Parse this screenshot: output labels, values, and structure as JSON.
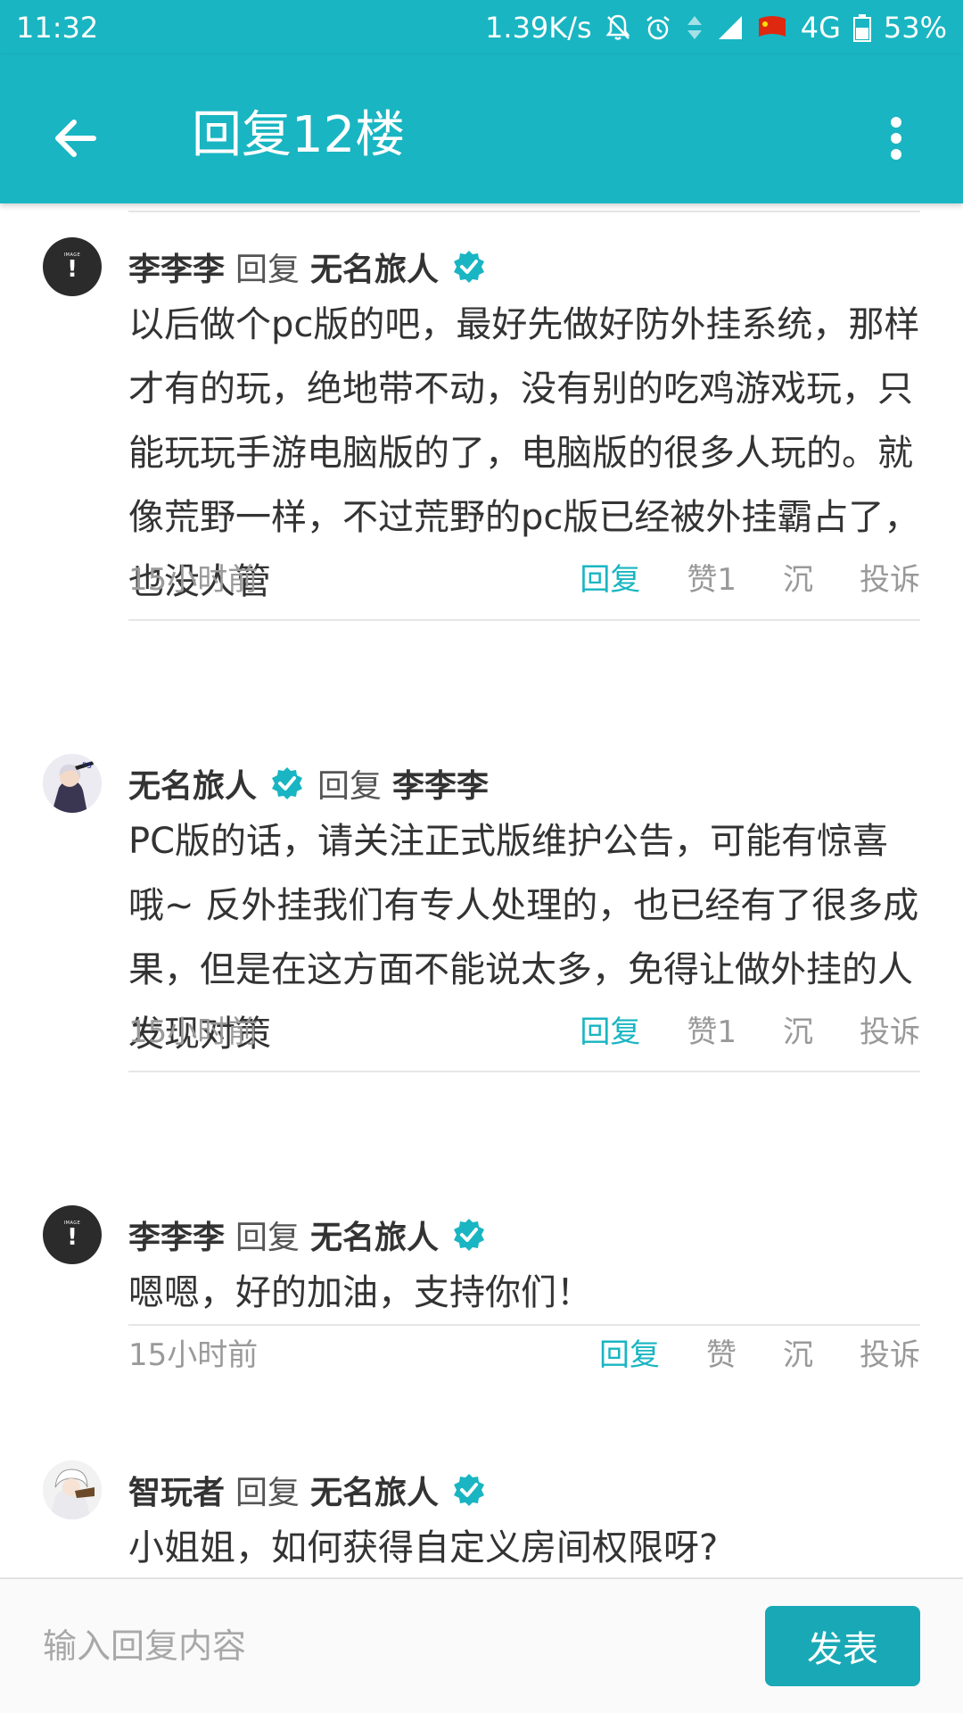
{
  "status_bar": {
    "time": "11:32",
    "net_speed": "1.39K/s",
    "network": "4G",
    "battery": "53%",
    "icons": [
      "mute-bell-icon",
      "alarm-icon",
      "data-arrows-icon",
      "signal-icon",
      "flag-icon",
      "battery-icon"
    ]
  },
  "header": {
    "title": "回复12楼",
    "back_icon": "back-arrow-icon",
    "more_icon": "more-vertical-icon"
  },
  "colors": {
    "accent": "#19b5c2",
    "text": "#333333",
    "muted": "#999999",
    "divider": "#e6e6e6"
  },
  "replies": [
    {
      "avatar": "default-avatar",
      "avatar_small_text": "IMAGE",
      "author": "李李李",
      "reply_word": "回复",
      "target": "无名旅人",
      "target_verified": true,
      "content": "以后做个pc版的吧，最好先做好防外挂系统，那样才有的玩，绝地带不动，没有别的吃鸡游戏玩，只能玩玩手游电脑版的了，电脑版的很多人玩的。就像荒野一样，不过荒野的pc版已经被外挂霸占了，也没人管",
      "time": "15小时前",
      "actions": {
        "reply": "回复",
        "like": "赞1",
        "sink": "沉",
        "report": "投诉"
      }
    },
    {
      "avatar": "anime-avatar",
      "author": "无名旅人",
      "author_verified": true,
      "reply_word": "回复",
      "target": "李李李",
      "content": "PC版的话，请关注正式版维护公告，可能有惊喜哦~ 反外挂我们有专人处理的，也已经有了很多成果，但是在这方面不能说太多，免得让做外挂的人发现对策",
      "time": "15小时前",
      "actions": {
        "reply": "回复",
        "like": "赞1",
        "sink": "沉",
        "report": "投诉"
      }
    },
    {
      "avatar": "default-avatar",
      "avatar_small_text": "IMAGE",
      "author": "李李李",
      "reply_word": "回复",
      "target": "无名旅人",
      "target_verified": true,
      "content": "嗯嗯，好的加油，支持你们！",
      "time": "15小时前",
      "actions": {
        "reply": "回复",
        "like": "赞",
        "sink": "沉",
        "report": "投诉"
      }
    },
    {
      "avatar": "anime-avatar",
      "author": "智玩者",
      "reply_word": "回复",
      "target": "无名旅人",
      "target_verified": true,
      "content": "小姐姐，如何获得自定义房间权限呀?"
    }
  ],
  "composer": {
    "placeholder": "输入回复内容",
    "value": "",
    "submit_label": "发表"
  }
}
